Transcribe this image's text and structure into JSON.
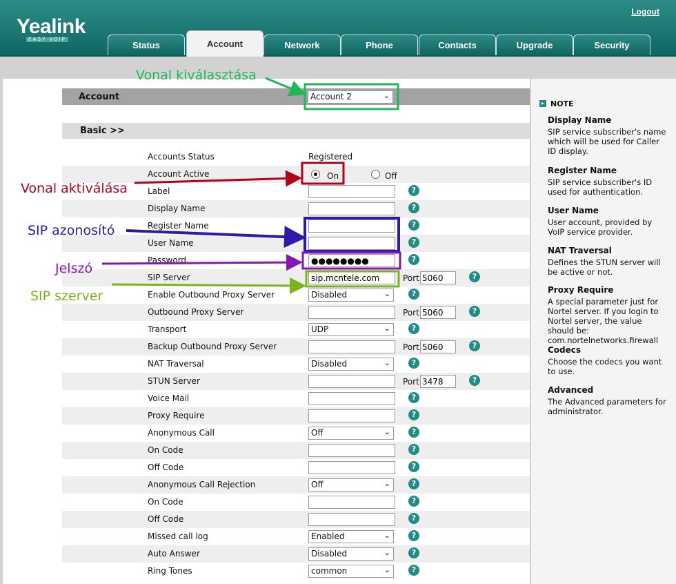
{
  "header": {
    "logo": "Yealink",
    "logo_sub": "EASY VOIP",
    "logout": "Logout",
    "tabs": [
      "Status",
      "Account",
      "Network",
      "Phone",
      "Contacts",
      "Upgrade",
      "Security"
    ],
    "active_tab": "Account"
  },
  "section": {
    "title": "Account",
    "account_select": "Account 2",
    "basic": "Basic >>"
  },
  "rows": [
    {
      "label": "Accounts Status",
      "value": "Registered"
    },
    {
      "label": "Account Active",
      "radio_on": "On",
      "radio_off": "Off",
      "selected": "On"
    },
    {
      "label": "Label",
      "value": ""
    },
    {
      "label": "Display Name",
      "value": ""
    },
    {
      "label": "Register Name",
      "value": ""
    },
    {
      "label": "User Name",
      "value": ""
    },
    {
      "label": "Password",
      "value": "●●●●●●●●"
    },
    {
      "label": "SIP Server",
      "value": "sip.mcntele.com",
      "port_label": "Port",
      "port": "5060"
    },
    {
      "label": "Enable Outbound Proxy Server",
      "value": "Disabled"
    },
    {
      "label": "Outbound Proxy Server",
      "value": "",
      "port_label": "Port",
      "port": "5060"
    },
    {
      "label": "Transport",
      "value": "UDP"
    },
    {
      "label": "Backup Outbound Proxy Server",
      "value": "",
      "port_label": "Port",
      "port": "5060"
    },
    {
      "label": "NAT Traversal",
      "value": "Disabled"
    },
    {
      "label": "STUN Server",
      "value": "",
      "port_label": "Port",
      "port": "3478"
    },
    {
      "label": "Voice Mail",
      "value": ""
    },
    {
      "label": "Proxy Require",
      "value": ""
    },
    {
      "label": "Anonymous Call",
      "value": "Off"
    },
    {
      "label": "On Code",
      "value": ""
    },
    {
      "label": "Off Code",
      "value": ""
    },
    {
      "label": "Anonymous Call Rejection",
      "value": "Off"
    },
    {
      "label": "On Code",
      "value": ""
    },
    {
      "label": "Off Code",
      "value": ""
    },
    {
      "label": "Missed call log",
      "value": "Enabled"
    },
    {
      "label": "Auto Answer",
      "value": "Disabled"
    },
    {
      "label": "Ring Tones",
      "value": "common"
    }
  ],
  "help_glyph": "?",
  "note": {
    "title": "NOTE",
    "items": [
      {
        "h": "Display Name",
        "t": "SIP service subscriber's name which will be used for Caller ID display."
      },
      {
        "h": "Register Name",
        "t": "SIP service subscriber's ID used for authentication."
      },
      {
        "h": "User Name",
        "t": "User account, provided by VoIP service provider."
      },
      {
        "h": "NAT Traversal",
        "t": "Defines the STUN server will be active or not."
      },
      {
        "h": "Proxy Require",
        "t": "A special parameter just for Nortel server. If you login to Nortel server, the value should be: com.nortelnetworks.firewall"
      },
      {
        "h": "Codecs",
        "t": "Choose the codecs you want to use."
      },
      {
        "h": "Advanced",
        "t": "The Advanced parameters for administrator."
      }
    ]
  },
  "annotations": {
    "line_select": "Vonal kiválasztása",
    "line_activate": "Vonal aktiválása",
    "sip_id": "SIP azonosító",
    "password": "Jelszó",
    "sip_server": "SIP szerver"
  },
  "colors": {
    "green": "#1db954",
    "red": "#b3001b",
    "blue": "#2d1aa8",
    "purple": "#8a15b5",
    "lime": "#7ab51d",
    "teal": "#1f8d86"
  }
}
